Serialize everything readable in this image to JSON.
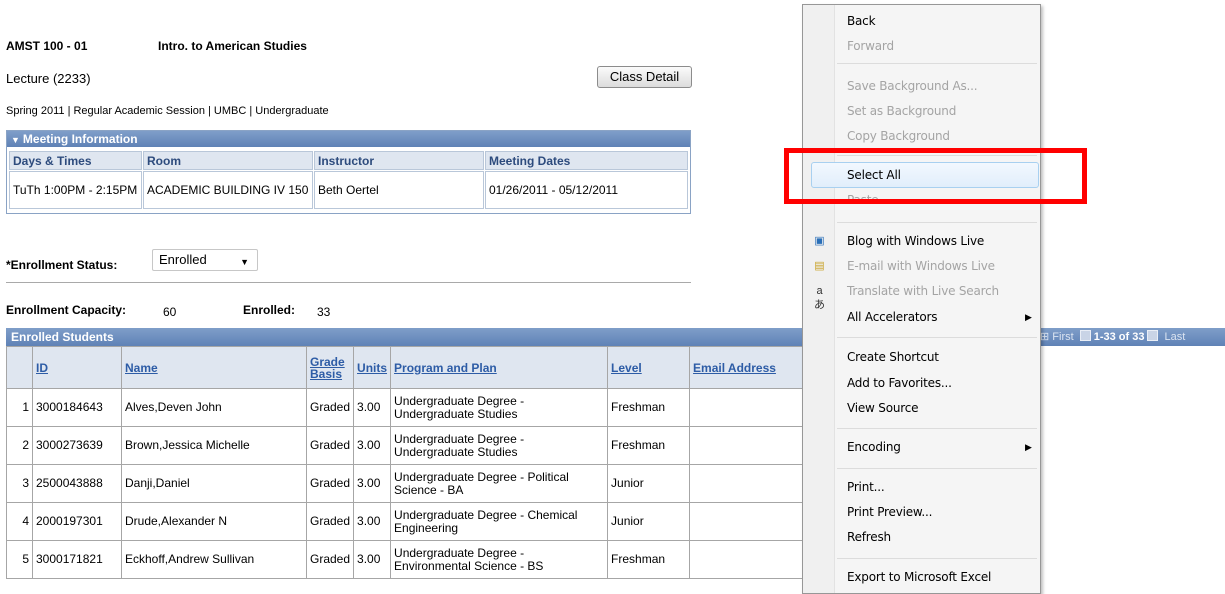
{
  "course": {
    "code": "AMST 100 - 01",
    "title": "Intro. to American Studies",
    "section": "Lecture  (2233)",
    "term_line": "Spring 2011  |  Regular Academic Session  |  UMBC  |  Undergraduate",
    "class_detail_button": "Class Detail"
  },
  "meeting": {
    "header": "Meeting Information",
    "columns": [
      "Days & Times",
      "Room",
      "Instructor",
      "Meeting Dates"
    ],
    "row": {
      "days_times": "TuTh 1:00PM - 2:15PM",
      "room": "ACADEMIC BUILDING IV 150",
      "instructor": "Beth Oertel",
      "dates": "01/26/2011 - 05/12/2011"
    }
  },
  "enrollment": {
    "status_label": "*Enrollment Status:",
    "status_value": "Enrolled",
    "capacity_label": "Enrollment Capacity:",
    "capacity_value": "60",
    "enrolled_label": "Enrolled:",
    "enrolled_value": "33"
  },
  "grid": {
    "title": "Enrolled Students",
    "nav_first": "First",
    "nav_range": "1-33 of 33",
    "nav_last": "Last",
    "columns": [
      "",
      "ID",
      "Name",
      "Grade Basis",
      "Units",
      "Program and Plan",
      "Level",
      "Email Address"
    ],
    "rows": [
      {
        "n": "1",
        "id": "3000184643",
        "name": "Alves,Deven John",
        "basis": "Graded",
        "units": "3.00",
        "plan": "Undergraduate Degree - Undergraduate Studies",
        "level": "Freshman",
        "email": ""
      },
      {
        "n": "2",
        "id": "3000273639",
        "name": "Brown,Jessica Michelle",
        "basis": "Graded",
        "units": "3.00",
        "plan": "Undergraduate Degree - Undergraduate Studies",
        "level": "Freshman",
        "email": ""
      },
      {
        "n": "3",
        "id": "2500043888",
        "name": "Danji,Daniel",
        "basis": "Graded",
        "units": "3.00",
        "plan": "Undergraduate Degree - Political Science - BA",
        "level": "Junior",
        "email": ""
      },
      {
        "n": "4",
        "id": "2000197301",
        "name": "Drude,Alexander N",
        "basis": "Graded",
        "units": "3.00",
        "plan": "Undergraduate Degree - Chemical Engineering",
        "level": "Junior",
        "email": ""
      },
      {
        "n": "5",
        "id": "3000171821",
        "name": "Eckhoff,Andrew Sullivan",
        "basis": "Graded",
        "units": "3.00",
        "plan": "Undergraduate Degree - Environmental Science - BS",
        "level": "Freshman",
        "email": ""
      }
    ]
  },
  "context_menu": {
    "items": [
      {
        "label": "Back",
        "disabled": false
      },
      {
        "label": "Forward",
        "disabled": true
      },
      {
        "label": "Save Background As...",
        "disabled": true
      },
      {
        "label": "Set as Background",
        "disabled": true
      },
      {
        "label": "Copy Background",
        "disabled": true
      },
      {
        "label": "Select All",
        "disabled": false
      },
      {
        "label": "Paste",
        "disabled": true
      },
      {
        "label": "Blog with Windows Live",
        "disabled": false,
        "icon": "windows-live-blog-icon"
      },
      {
        "label": "E-mail with Windows Live",
        "disabled": true,
        "icon": "windows-live-mail-icon"
      },
      {
        "label": "Translate with Live Search",
        "disabled": true,
        "icon": "translate-icon"
      },
      {
        "label": "All Accelerators",
        "disabled": false
      },
      {
        "label": "Create Shortcut",
        "disabled": false
      },
      {
        "label": "Add to Favorites...",
        "disabled": false
      },
      {
        "label": "View Source",
        "disabled": false
      },
      {
        "label": "Encoding",
        "disabled": false
      },
      {
        "label": "Print...",
        "disabled": false
      },
      {
        "label": "Print Preview...",
        "disabled": false
      },
      {
        "label": "Refresh",
        "disabled": false
      },
      {
        "label": "Export to Microsoft Excel",
        "disabled": false
      }
    ]
  },
  "colors": {
    "highlight": "#ff0000",
    "grid_header": "#5f82b6",
    "menu_hover": "#e1eefb"
  }
}
